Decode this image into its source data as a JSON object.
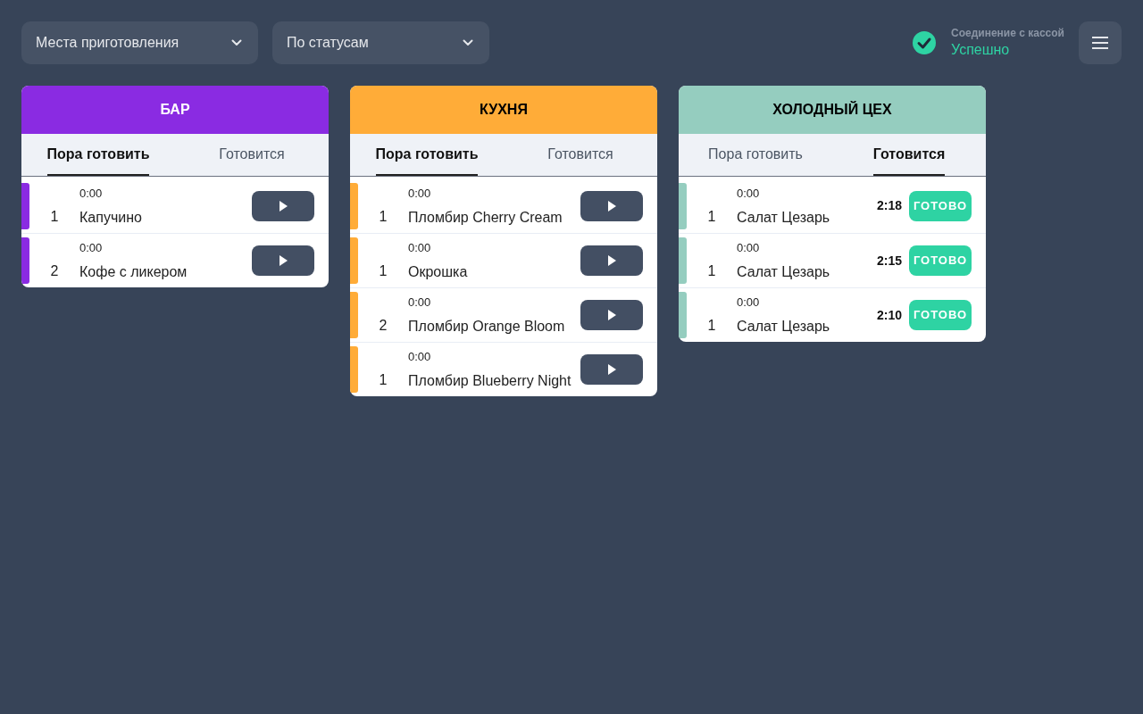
{
  "filters": [
    {
      "label": "Места приготовления"
    },
    {
      "label": "По статусам"
    }
  ],
  "connection": {
    "caption": "Соединение с кассой",
    "status": "Успешно",
    "ok": true
  },
  "stations": [
    {
      "title": "БАР",
      "color": "#8a2be2",
      "tabs": [
        {
          "label": "Пора готовить",
          "selected": true
        },
        {
          "label": "Готовится",
          "selected": false
        }
      ],
      "items": [
        {
          "kind": "queued",
          "time": "0:00",
          "qty": "1",
          "name": "Капучино"
        },
        {
          "kind": "queued",
          "time": "0:00",
          "qty": "2",
          "name": "Кофе с ликером"
        }
      ]
    },
    {
      "title": "КУХНЯ",
      "color": "#ffac38",
      "tabs": [
        {
          "label": "Пора готовить",
          "selected": true
        },
        {
          "label": "Готовится",
          "selected": false
        }
      ],
      "items": [
        {
          "kind": "queued",
          "time": "0:00",
          "qty": "1",
          "name": "Пломбир Cherry Cream"
        },
        {
          "kind": "queued",
          "time": "0:00",
          "qty": "1",
          "name": "Окрошка"
        },
        {
          "kind": "queued",
          "time": "0:00",
          "qty": "2",
          "name": "Пломбир Orange Bloom"
        },
        {
          "kind": "queued",
          "time": "0:00",
          "qty": "1",
          "name": "Пломбир Blueberry Night"
        }
      ]
    },
    {
      "title": "ХОЛОДНЫЙ ЦЕХ",
      "color": "#95cdbf",
      "tabs": [
        {
          "label": "Пора готовить",
          "selected": false
        },
        {
          "label": "Готовится",
          "selected": true
        }
      ],
      "items": [
        {
          "kind": "cooking",
          "time": "0:00",
          "qty": "1",
          "name": "Салат Цезарь",
          "elapsed": "2:18",
          "action": "ГОТОВО"
        },
        {
          "kind": "cooking",
          "time": "0:00",
          "qty": "1",
          "name": "Салат Цезарь",
          "elapsed": "2:15",
          "action": "ГОТОВО"
        },
        {
          "kind": "cooking",
          "time": "0:00",
          "qty": "1",
          "name": "Салат Цезарь",
          "elapsed": "2:10",
          "action": "ГОТОВО"
        }
      ]
    }
  ]
}
